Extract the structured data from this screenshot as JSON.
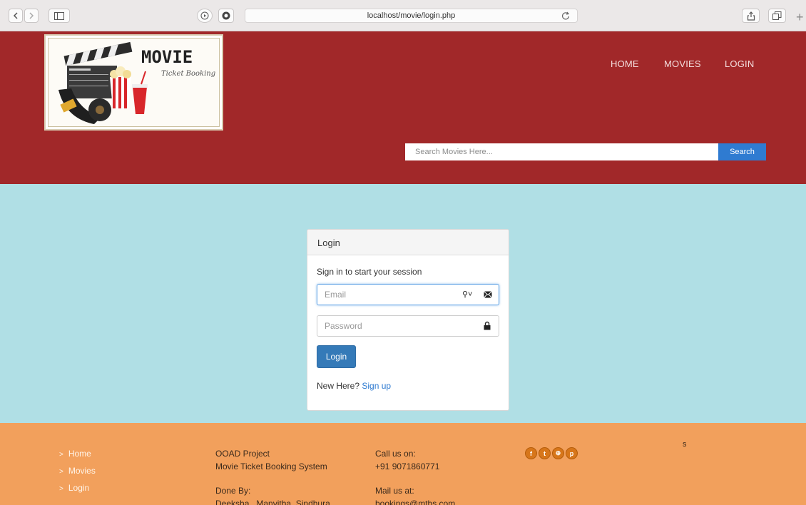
{
  "browser": {
    "url": "localhost/movie/login.php"
  },
  "header": {
    "logo_title": "MOVIE",
    "logo_subtitle": "Ticket Booking",
    "nav": [
      {
        "label": "HOME"
      },
      {
        "label": "MOVIES"
      },
      {
        "label": "LOGIN"
      }
    ],
    "search_placeholder": "Search Movies Here...",
    "search_button": "Search"
  },
  "login": {
    "title": "Login",
    "message": "Sign in to start your session",
    "email_placeholder": "Email",
    "password_placeholder": "Password",
    "button": "Login",
    "new_here": "New Here?",
    "signup_link": "Sign up"
  },
  "footer": {
    "links": [
      {
        "label": "Home"
      },
      {
        "label": "Movies"
      },
      {
        "label": "Login"
      }
    ],
    "project_line1": "OOAD Project",
    "project_line2": "Movie Ticket Booking System",
    "done_by_label": "Done By:",
    "done_by_names": "Deeksha , Manvitha, Sindhura",
    "call_label": "Call us on:",
    "phone": "+91 9071860771",
    "mail_label": "Mail us at:",
    "email": "bookings@mtbs.com",
    "stray_text": "s",
    "social": [
      {
        "icon": "facebook-icon",
        "glyph": "f"
      },
      {
        "icon": "twitter-icon",
        "glyph": "t"
      },
      {
        "icon": "dribbble-icon",
        "glyph": "⊕"
      },
      {
        "icon": "pinterest-icon",
        "glyph": "p"
      }
    ]
  }
}
